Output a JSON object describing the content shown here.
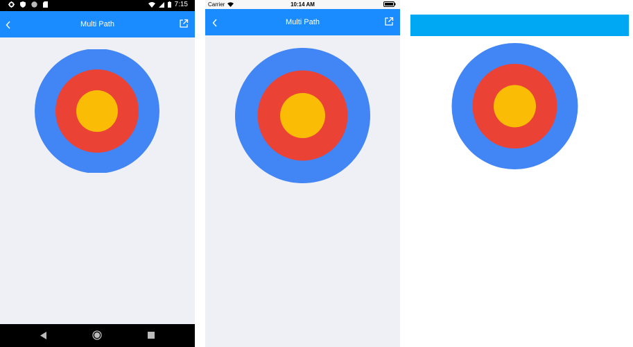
{
  "android": {
    "status_time": "7:15",
    "icons": [
      "gear-icon",
      "shield-icon",
      "circle-icon",
      "sd-card-icon",
      "wifi-icon",
      "signal-icon",
      "battery-icon"
    ],
    "title": "Multi Path",
    "back_icon": "chevron-left-icon",
    "open_icon": "external-link-icon",
    "nav_icons": [
      "back-triangle-icon",
      "home-circle-icon",
      "recents-square-icon"
    ]
  },
  "ios": {
    "carrier": "Carrier",
    "time": "10:14 AM",
    "title": "Multi Path",
    "back_icon": "chevron-left-icon",
    "open_icon": "external-link-icon"
  },
  "web": {
    "header_color": "#00a8f3"
  },
  "colors": {
    "outer_ring": "#4285f4",
    "middle_ring": "#ea4335",
    "inner_circle": "#fbbc05",
    "appbar": "#1a8cff"
  }
}
